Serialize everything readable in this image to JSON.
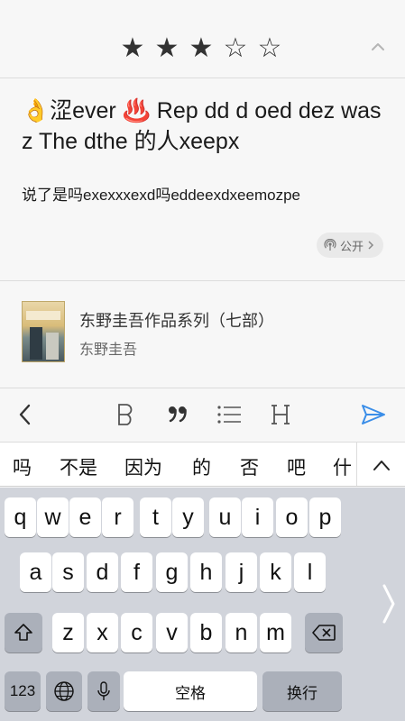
{
  "rating": {
    "filled": 3,
    "total": 5,
    "filled_glyph": "★",
    "empty_glyph": "☆"
  },
  "review": {
    "title": "👌涩ever ♨️   Rep dd d oed dez was z The dthe  的人xeepx",
    "body": "说了是吗exexxxexd吗eddeexdxeemozpe",
    "visibility": "公开"
  },
  "book": {
    "title": "东野圭吾作品系列（七部）",
    "author": "东野圭吾"
  },
  "toolbar": {
    "icons": [
      "chevron-left-icon",
      "bold-icon",
      "quote-icon",
      "list-icon",
      "heading-icon",
      "send-icon"
    ],
    "accent": "#3b8ee8"
  },
  "candidates": [
    "吗",
    "不是",
    "因为",
    "的",
    "否",
    "吧",
    "什"
  ],
  "keyboard": {
    "row1": [
      "q",
      "w",
      "e",
      "r",
      "t",
      "y",
      "u",
      "i",
      "o",
      "p"
    ],
    "row2": [
      "a",
      "s",
      "d",
      "f",
      "g",
      "h",
      "j",
      "k",
      "l"
    ],
    "row3": [
      "z",
      "x",
      "c",
      "v",
      "b",
      "n",
      "m"
    ],
    "numbers_label": "123",
    "space_label": "空格",
    "return_label": "换行"
  }
}
